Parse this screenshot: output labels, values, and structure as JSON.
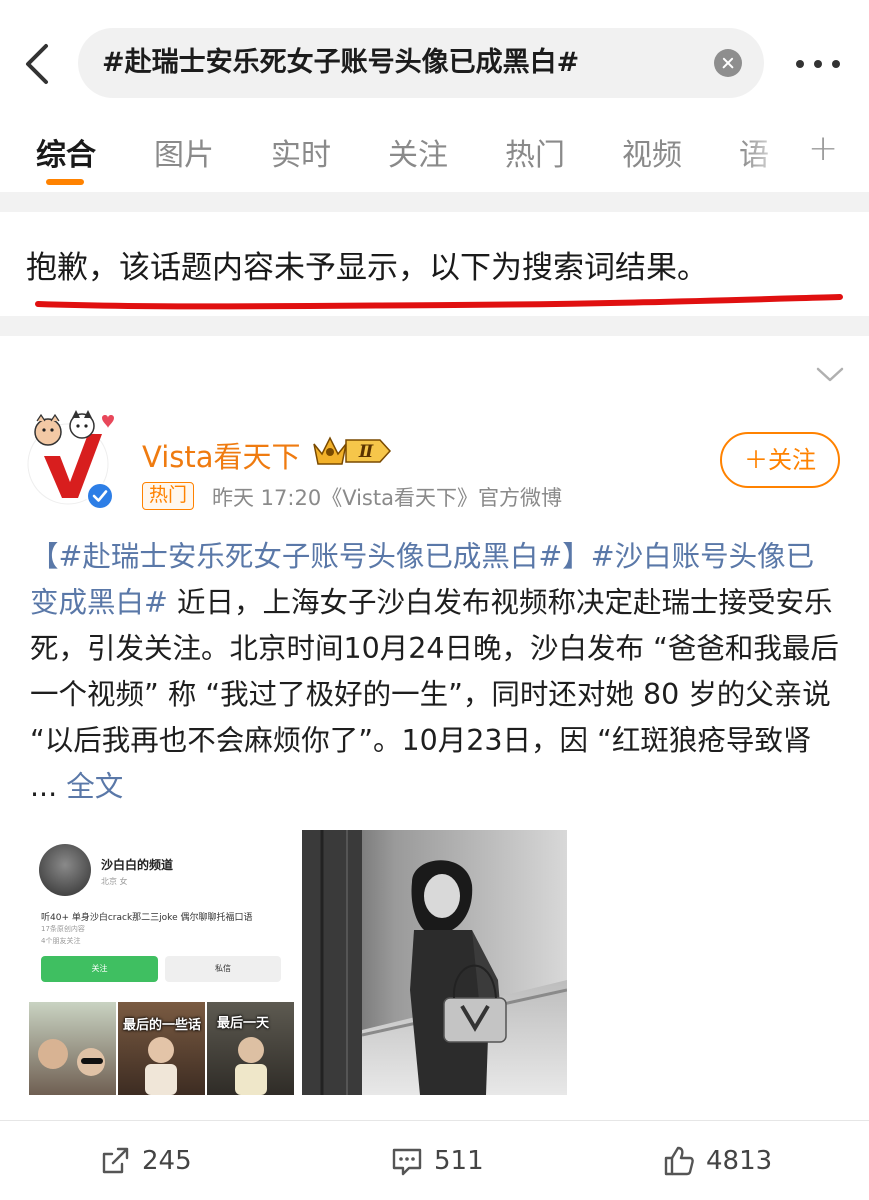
{
  "search": {
    "query": "#赴瑞士安乐死女子账号头像已成黑白#"
  },
  "tabs": [
    {
      "label": "综合"
    },
    {
      "label": "图片"
    },
    {
      "label": "实时"
    },
    {
      "label": "关注"
    },
    {
      "label": "热门"
    },
    {
      "label": "视频"
    },
    {
      "label": "语"
    }
  ],
  "active_tab": "综合",
  "notice": {
    "text": "抱歉，该话题内容未予显示，以下为搜索词结果。"
  },
  "post": {
    "author": "Vista看天下",
    "vip_level": "Ⅱ",
    "badge": "热门",
    "meta": "昨天 17:20《Vista看天下》官方微博",
    "follow_label": "＋关注",
    "tag1": "【#赴瑞士安乐死女子账号头像已成黑白#】",
    "tag2": "#沙白账号头像已变成黑白#",
    "body": " 近日，上海女子沙白发布视频称决定赴瑞士接受安乐死，引发关注。北京时间10月24日晚，沙白发布 “爸爸和我最后一个视频” 称 “我过了极好的一生”，同时还对她 80 岁的父亲说 “以后我再也不会麻烦你了”。10月23日，因 “红斑狼疮导致肾 ... ",
    "more_link": "全文",
    "image1": {
      "profile_name": "沙白白的频道",
      "location": "北京 女",
      "bio": "听40+ 单身沙白crack那二三joke 偶尔聊聊托福口语",
      "stat1": "17条原创内容",
      "stat2": "4个朋友关注",
      "follow": "关注",
      "message": "私信",
      "thumb2_label": "最后的一些话",
      "thumb3_label": "最后一天"
    },
    "reposts": "245",
    "comments": "511",
    "likes": "4813"
  },
  "colors": {
    "accent": "#ff8200",
    "author": "#ef7b10",
    "hashtag": "#5a78a8",
    "annotation_red": "#e01010",
    "separator": "#f2f2f2"
  }
}
